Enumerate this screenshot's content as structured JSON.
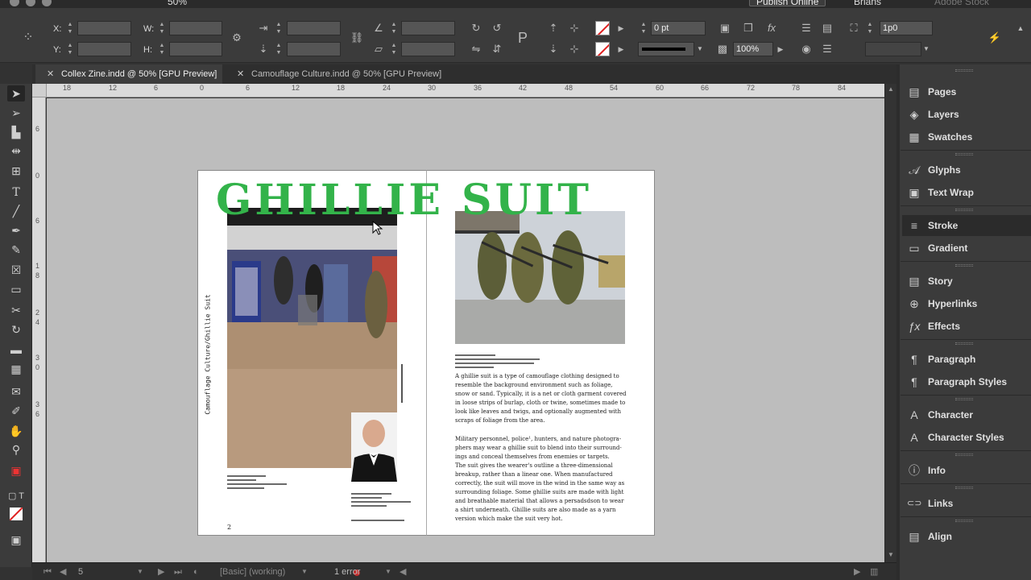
{
  "appbar": {
    "zoom_label": "50%",
    "publish_label": "Publish Online",
    "user_label": "Brians",
    "stock_placeholder": "Adobe Stock"
  },
  "control_panel": {
    "x_label": "X:",
    "y_label": "Y:",
    "w_label": "W:",
    "h_label": "H:",
    "stroke_weight": "0 pt",
    "opacity": "100%",
    "offset": "1p0"
  },
  "tabs": [
    {
      "label": "Collex Zine.indd @ 50% [GPU Preview]",
      "active": true
    },
    {
      "label": "Camouflage Culture.indd @ 50% [GPU Preview]",
      "active": false
    }
  ],
  "ruler_h": [
    "18",
    "12",
    "6",
    "0",
    "6",
    "12",
    "18",
    "24",
    "30",
    "36",
    "42",
    "48",
    "54",
    "60",
    "66",
    "72",
    "78",
    "84"
  ],
  "ruler_v": [
    "6",
    "0",
    "6",
    "1",
    "8",
    "2",
    "4",
    "3",
    "0",
    "3",
    "6"
  ],
  "document": {
    "headline": "GHILLIE SUIT",
    "vertical_caption": "Camouflage Culture/Ghillie Suit",
    "body_paragraph_1": "A ghillie suit is a type of camouflage clothing designed to\nresemble the background environment such as foliage,\nsnow or sand. Typically, it is a net or cloth garment covered\nin loose strips of burlap, cloth or twine, sometimes made to\nlook like leaves and twigs, and optionally augmented with\nscraps of foliage from the area.",
    "body_paragraph_2": "Military personnel, police¹, hunters, and nature photogra-\nphers may wear a ghillie suit to blend into their surround-\nings and conceal themselves from enemies or targets.\nThe suit gives the wearer's outline a three-dimensional\nbreakup, rather than a linear one. When manufactured\ncorrectly, the suit will move in the wind in the same way as\nsurrounding foliage. Some ghillie suits are made with light\nand breathable material that allows a persadsdson to wear\na shirt underneath. Ghillie suits are also made as a yarn\nversion which make the suit very hot.",
    "page_number": "2"
  },
  "status_bar": {
    "page_field": "5",
    "profile": "[Basic] (working)",
    "errors": "1 error"
  },
  "panels": [
    {
      "label": "Pages",
      "icon": "pages-icon",
      "glyph": "▤"
    },
    {
      "label": "Layers",
      "icon": "layers-icon",
      "glyph": "◈"
    },
    {
      "label": "Swatches",
      "icon": "swatches-icon",
      "glyph": "▦"
    },
    {
      "label": "Glyphs",
      "icon": "glyphs-icon",
      "glyph": "𝒜"
    },
    {
      "label": "Text Wrap",
      "icon": "text-wrap-icon",
      "glyph": "▣"
    },
    {
      "label": "Stroke",
      "icon": "stroke-icon",
      "glyph": "≡"
    },
    {
      "label": "Gradient",
      "icon": "gradient-icon",
      "glyph": "▭"
    },
    {
      "label": "Story",
      "icon": "story-icon",
      "glyph": "▤"
    },
    {
      "label": "Hyperlinks",
      "icon": "hyperlinks-icon",
      "glyph": "⊕"
    },
    {
      "label": "Effects",
      "icon": "effects-icon",
      "glyph": "ƒx"
    },
    {
      "label": "Paragraph",
      "icon": "paragraph-icon",
      "glyph": "¶"
    },
    {
      "label": "Paragraph Styles",
      "icon": "paragraph-styles-icon",
      "glyph": "¶"
    },
    {
      "label": "Character",
      "icon": "character-icon",
      "glyph": "A"
    },
    {
      "label": "Character Styles",
      "icon": "character-styles-icon",
      "glyph": "A"
    },
    {
      "label": "Info",
      "icon": "info-icon",
      "glyph": "ⓘ"
    },
    {
      "label": "Links",
      "icon": "links-icon",
      "glyph": "⊂⊃"
    },
    {
      "label": "Align",
      "icon": "align-icon",
      "glyph": "▤"
    }
  ],
  "colors": {
    "headline_green": "#33b34a",
    "panel_bg": "#3b3b3b",
    "pasteboard": "#bdbdbd",
    "error_red": "#c42a2a"
  }
}
